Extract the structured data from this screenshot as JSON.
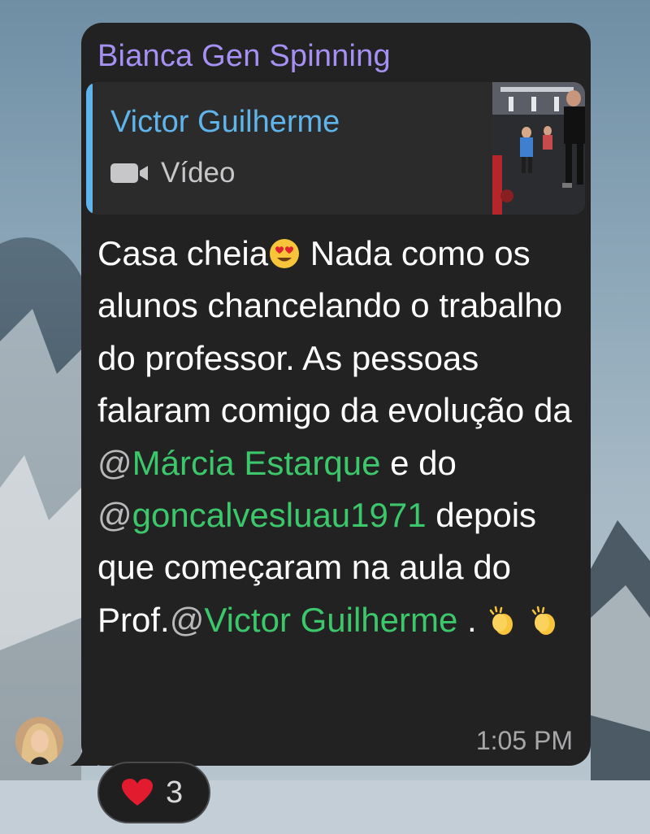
{
  "message": {
    "sender": "Bianca Gen Spinning",
    "reply": {
      "name": "Victor Guilherme",
      "type_label": "Vídeo",
      "type_icon": "video-camera-icon"
    },
    "text": {
      "part1": "Casa cheia",
      "part2": " Nada como os alunos chancelando o trabalho do professor. As pessoas falaram comigo da evolução da ",
      "mention1_at": "@",
      "mention1_name": "Márcia Estarque",
      "part3": " e do ",
      "mention2_at": "@",
      "mention2_name": "goncalvesluau1971",
      "part4": " depois que começaram na aula do Prof.",
      "mention3_at": "@",
      "mention3_name": "Victor Guilherme",
      "part5": " . "
    },
    "time": "1:05 PM"
  },
  "reaction": {
    "icon": "heart-icon",
    "count": "3"
  },
  "colors": {
    "bubble": "#222223",
    "sender": "#a690f4",
    "reply_accent": "#5fb4ea",
    "mention": "#3cc76b"
  }
}
